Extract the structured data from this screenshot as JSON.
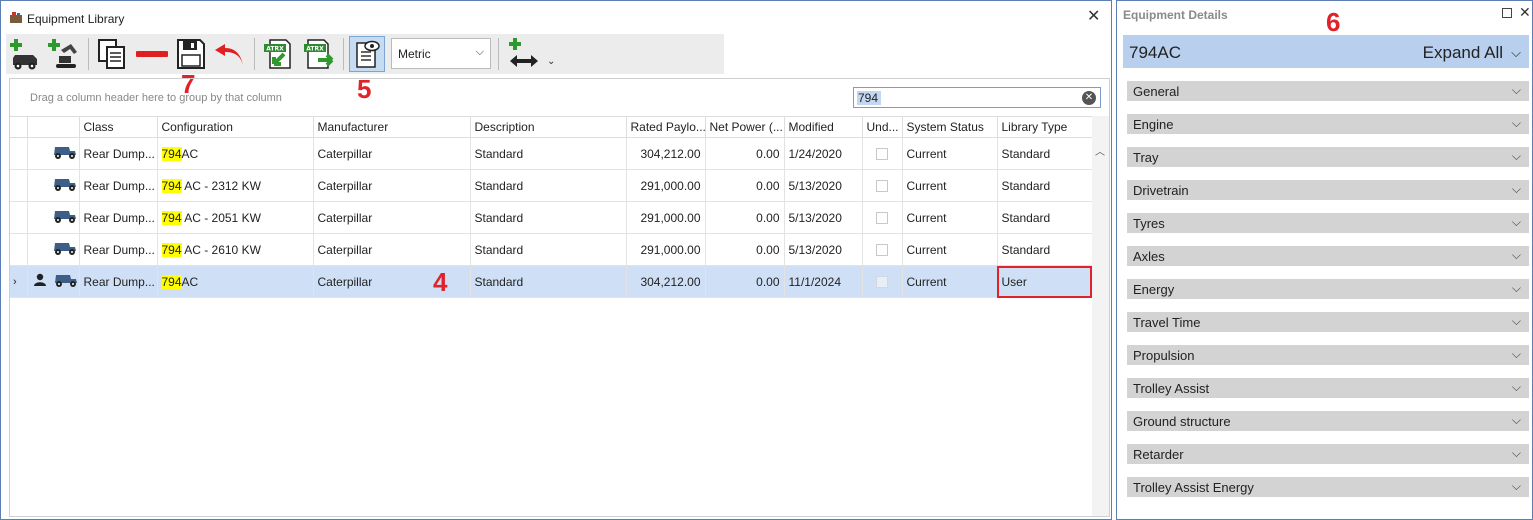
{
  "window": {
    "title": "Equipment Library"
  },
  "toolbar": {
    "unit_system": "Metric",
    "atrx_label": "ATRX"
  },
  "callouts": {
    "c4": "4",
    "c5": "5",
    "c6": "6",
    "c7": "7"
  },
  "grid": {
    "group_hint": "Drag a column header here to group by that column",
    "search_value": "794",
    "columns": [
      "Class",
      "Configuration",
      "Manufacturer",
      "Description",
      "Rated Paylo...",
      "Net Power (...",
      "Modified",
      "Und...",
      "System Status",
      "Library Type"
    ],
    "rows": [
      {
        "class": "Rear Dump...",
        "config_hl": "794",
        "config_rest": "AC",
        "manufacturer": "Caterpillar",
        "description": "Standard",
        "rated_payload": "304,212.00",
        "net_power": "0.00",
        "modified": "1/24/2020",
        "status": "Current",
        "library_type": "Standard"
      },
      {
        "class": "Rear Dump...",
        "config_hl": "794",
        "config_rest": " AC - 2312 KW",
        "manufacturer": "Caterpillar",
        "description": "Standard",
        "rated_payload": "291,000.00",
        "net_power": "0.00",
        "modified": "5/13/2020",
        "status": "Current",
        "library_type": "Standard"
      },
      {
        "class": "Rear Dump...",
        "config_hl": "794",
        "config_rest": " AC - 2051 KW",
        "manufacturer": "Caterpillar",
        "description": "Standard",
        "rated_payload": "291,000.00",
        "net_power": "0.00",
        "modified": "5/13/2020",
        "status": "Current",
        "library_type": "Standard"
      },
      {
        "class": "Rear Dump...",
        "config_hl": "794",
        "config_rest": " AC - 2610 KW",
        "manufacturer": "Caterpillar",
        "description": "Standard",
        "rated_payload": "291,000.00",
        "net_power": "0.00",
        "modified": "5/13/2020",
        "status": "Current",
        "library_type": "Standard"
      },
      {
        "class": "Rear Dump...",
        "config_hl": "794",
        "config_rest": "AC",
        "manufacturer": "Caterpillar",
        "description": "Standard",
        "rated_payload": "304,212.00",
        "net_power": "0.00",
        "modified": "11/1/2024",
        "status": "Current",
        "library_type": "User"
      }
    ]
  },
  "details": {
    "panel_title": "Equipment Details",
    "equipment_name": "794AC",
    "expand_all_label": "Expand All",
    "sections": [
      "General",
      "Engine",
      "Tray",
      "Drivetrain",
      "Tyres",
      "Axles",
      "Energy",
      "Travel Time",
      "Propulsion",
      "Trolley Assist",
      "Ground structure",
      "Retarder",
      "Trolley Assist Energy"
    ]
  },
  "colors": {
    "accent": "#5b7fb5",
    "selected_row": "#cfe0f6",
    "highlight": "#ffff00",
    "callout": "#e0222a",
    "green": "#2e9a2e",
    "red": "#e02020"
  }
}
